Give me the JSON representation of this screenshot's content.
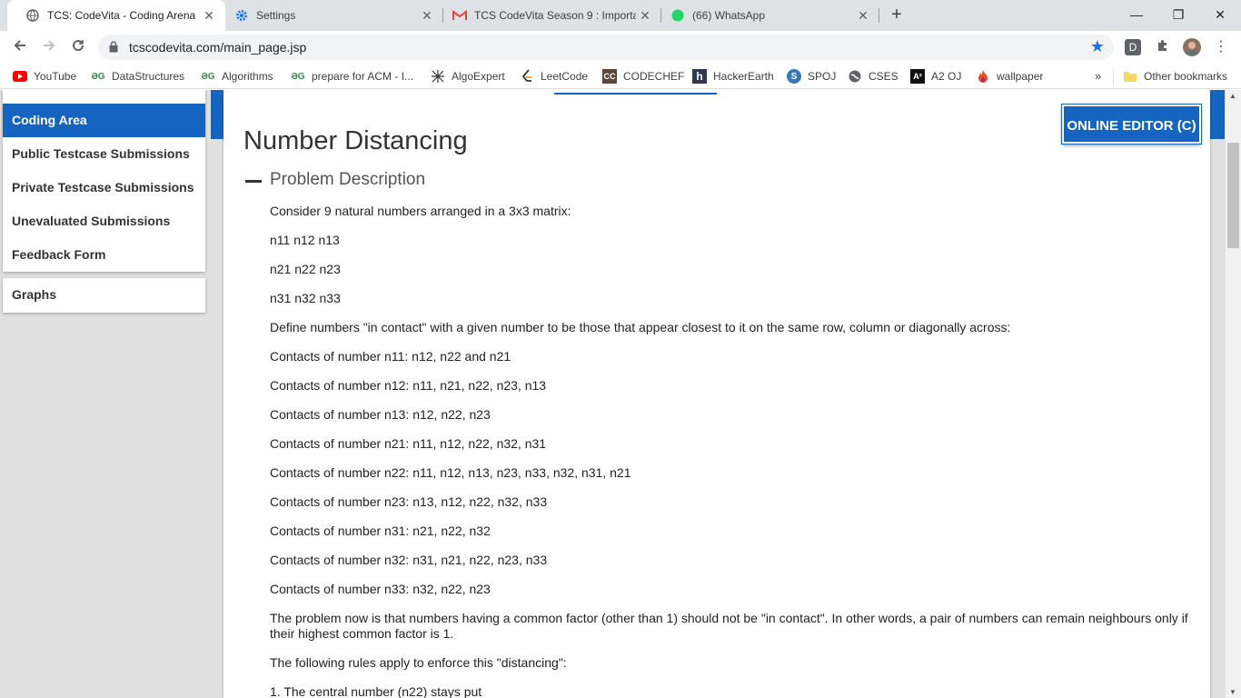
{
  "tabs": [
    {
      "title": "TCS: CodeVita - Coding Arena",
      "favicon": "globe-icon"
    },
    {
      "title": "Settings",
      "favicon": "gear-icon"
    },
    {
      "title": "TCS CodeVita Season 9 : Importa",
      "favicon": "gmail-icon"
    },
    {
      "title": "(66) WhatsApp",
      "favicon": "whatsapp-icon"
    }
  ],
  "close_glyph": "✕",
  "new_tab_glyph": "+",
  "window_controls": {
    "minimize": "—",
    "restore": "❐",
    "close": "✕"
  },
  "address": {
    "url": "tcscodevita.com/main_page.jsp"
  },
  "extensions": {
    "d_label": "D"
  },
  "bookmarks": [
    {
      "label": "YouTube",
      "icon": "youtube-icon"
    },
    {
      "label": "DataStructures",
      "icon": "gfg-icon"
    },
    {
      "label": "Algorithms",
      "icon": "gfg-icon"
    },
    {
      "label": "prepare for ACM - I...",
      "icon": "gfg-icon"
    },
    {
      "label": "AlgoExpert",
      "icon": "algoexpert-icon"
    },
    {
      "label": "LeetCode",
      "icon": "leetcode-icon"
    },
    {
      "label": "CODECHEF",
      "icon": "codechef-icon"
    },
    {
      "label": "HackerEarth",
      "icon": "hackerearth-icon"
    },
    {
      "label": "SPOJ",
      "icon": "spoj-icon"
    },
    {
      "label": "CSES",
      "icon": "globe-icon"
    },
    {
      "label": "A2 OJ",
      "icon": "a2oj-icon"
    },
    {
      "label": "wallpaper",
      "icon": "fire-icon"
    }
  ],
  "bookmarks_overflow": "»",
  "other_bookmarks": "Other bookmarks",
  "sidebar": {
    "items": [
      {
        "label": "Coding Area",
        "active": true
      },
      {
        "label": "Public Testcase Submissions"
      },
      {
        "label": "Private Testcase Submissions"
      },
      {
        "label": "Unevaluated Submissions"
      },
      {
        "label": "Feedback Form"
      }
    ],
    "graphs_label": "Graphs"
  },
  "editor_button": "ONLINE EDITOR (C)",
  "problem": {
    "title": "Number Distancing",
    "section": "Problem Description",
    "paragraphs": [
      "Consider 9 natural numbers arranged in a 3x3 matrix:",
      "n11 n12 n13",
      "n21 n22 n23",
      "n31 n32 n33",
      "Define numbers \"in contact\" with a given number to be those that appear closest to it on the same row, column or diagonally across:",
      "Contacts of number n11: n12, n22 and n21",
      "Contacts of number n12: n11, n21, n22, n23, n13",
      "Contacts of number n13: n12, n22, n23",
      "Contacts of number n21: n11, n12, n22, n32, n31",
      "Contacts of number n22: n11, n12, n13, n23, n33, n32, n31, n21",
      "Contacts of number n23: n13, n12, n22, n32, n33",
      "Contacts of number n31: n21, n22, n32",
      "Contacts of number n32: n31, n21, n22, n23, n33",
      "Contacts of number n33: n32, n22, n23",
      "The problem now is that numbers having a common factor (other than 1) should not be \"in contact\". In other words, a pair of numbers can remain neighbours only if their highest common factor is 1.",
      "The following rules apply to enforce this \"distancing\":",
      "1. The central number (n22) stays put"
    ]
  },
  "colors": {
    "accent": "#1565c0",
    "page_bg": "#e0e0e0"
  }
}
